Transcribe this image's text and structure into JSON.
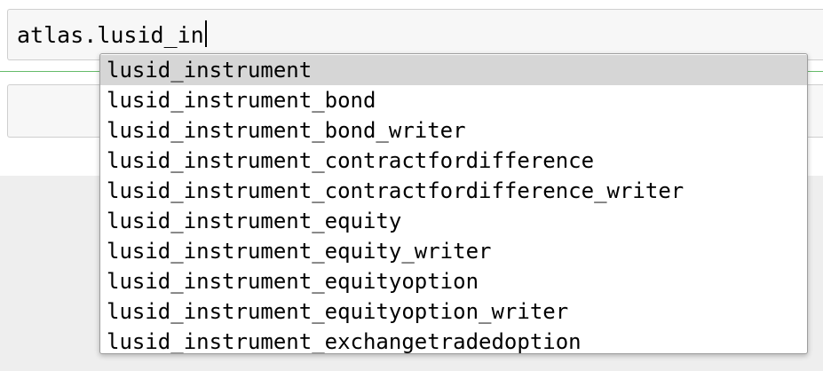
{
  "cell": {
    "input_text": "atlas.lusid_in"
  },
  "completer": {
    "selected_index": 0,
    "items": [
      "lusid_instrument",
      "lusid_instrument_bond",
      "lusid_instrument_bond_writer",
      "lusid_instrument_contractfordifference",
      "lusid_instrument_contractfordifference_writer",
      "lusid_instrument_equity",
      "lusid_instrument_equity_writer",
      "lusid_instrument_equityoption",
      "lusid_instrument_equityoption_writer",
      "lusid_instrument_exchangetradedoption"
    ]
  },
  "colors": {
    "selected_item_bg": "#d6d6d6",
    "output_divider": "#66bb6a",
    "cell_bg": "#f7f7f7"
  }
}
